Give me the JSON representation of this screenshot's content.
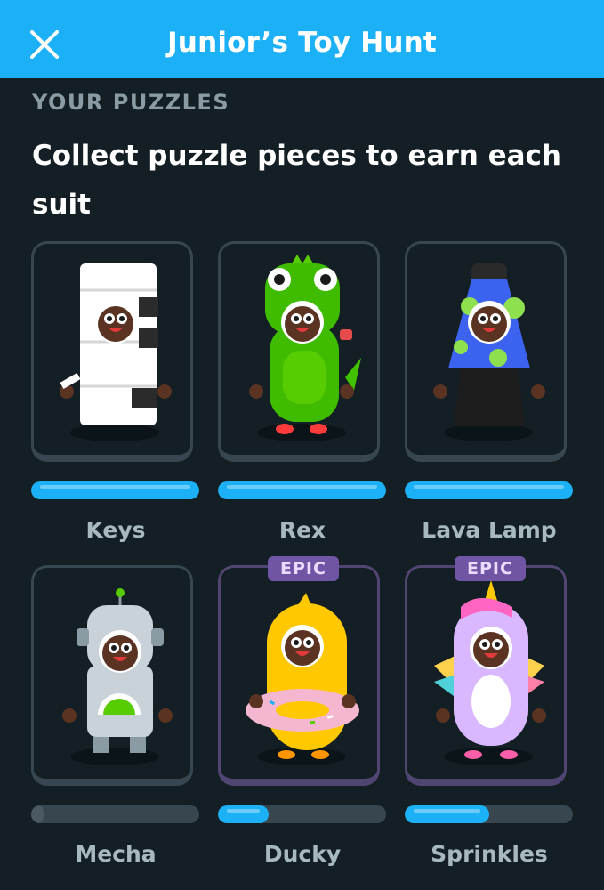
{
  "header": {
    "title": "Junior’s Toy Hunt",
    "close_icon": "close-icon"
  },
  "section_label": "YOUR PUZZLES",
  "headline": "Collect puzzle pieces to earn each suit",
  "colors": {
    "accent": "#1cb0f6",
    "background": "#131f24",
    "epic": "#6f55a4"
  },
  "suits": [
    {
      "name": "Keys",
      "epic": false,
      "badge": "",
      "progress": 1.0
    },
    {
      "name": "Rex",
      "epic": false,
      "badge": "",
      "progress": 1.0
    },
    {
      "name": "Lava Lamp",
      "epic": false,
      "badge": "",
      "progress": 1.0
    },
    {
      "name": "Mecha",
      "epic": false,
      "badge": "",
      "progress": 0.0
    },
    {
      "name": "Ducky",
      "epic": true,
      "badge": "EPIC",
      "progress": 0.3
    },
    {
      "name": "Sprinkles",
      "epic": true,
      "badge": "EPIC",
      "progress": 0.5
    }
  ]
}
